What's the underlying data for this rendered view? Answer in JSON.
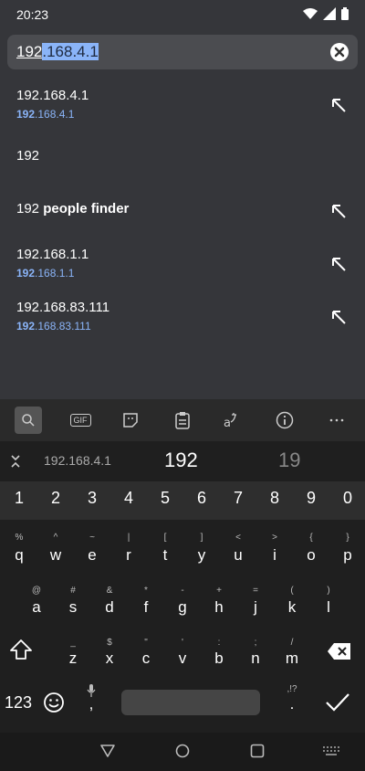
{
  "status": {
    "time": "20:23"
  },
  "url_bar": {
    "typed": "192",
    "selected": ".168.4.1"
  },
  "suggestions": [
    {
      "title": "192.168.4.1",
      "subtitle_bold": "192",
      "subtitle_rest": ".168.4.1",
      "arrow": true
    },
    {
      "title": "192",
      "subtitle_bold": "",
      "subtitle_rest": "",
      "arrow": false
    },
    {
      "title_plain": "192 ",
      "title_bold": "people finder",
      "arrow": true
    },
    {
      "title": "192.168.1.1",
      "subtitle_bold": "192",
      "subtitle_rest": ".168.1.1",
      "arrow": true
    },
    {
      "title": "192.168.83.111",
      "subtitle_bold": "192",
      "subtitle_rest": ".168.83.111",
      "arrow": true
    }
  ],
  "keyboard": {
    "toolbar_gif": "GIF",
    "prediction_left": "192.168.4.1",
    "prediction_center": "192",
    "prediction_right": "19",
    "numbers": [
      "1",
      "2",
      "3",
      "4",
      "5",
      "6",
      "7",
      "8",
      "9",
      "0"
    ],
    "row1": [
      "q",
      "w",
      "e",
      "r",
      "t",
      "y",
      "u",
      "i",
      "o",
      "p"
    ],
    "row1_hints": [
      "%",
      "^",
      "~",
      "|",
      "[",
      "]",
      "<",
      ">",
      "{",
      "}"
    ],
    "row2": [
      "a",
      "s",
      "d",
      "f",
      "g",
      "h",
      "j",
      "k",
      "l"
    ],
    "row2_hints": [
      "@",
      "#",
      "&",
      "*",
      "-",
      "+",
      "=",
      "(",
      ")"
    ],
    "row3": [
      "z",
      "x",
      "c",
      "v",
      "b",
      "n",
      "m"
    ],
    "row3_hints": [
      "_",
      "$",
      "\"",
      "'",
      ":",
      ";",
      "/"
    ],
    "key_123": "123",
    "comma": ",",
    "period": ".",
    "period_hint": ",!?"
  }
}
